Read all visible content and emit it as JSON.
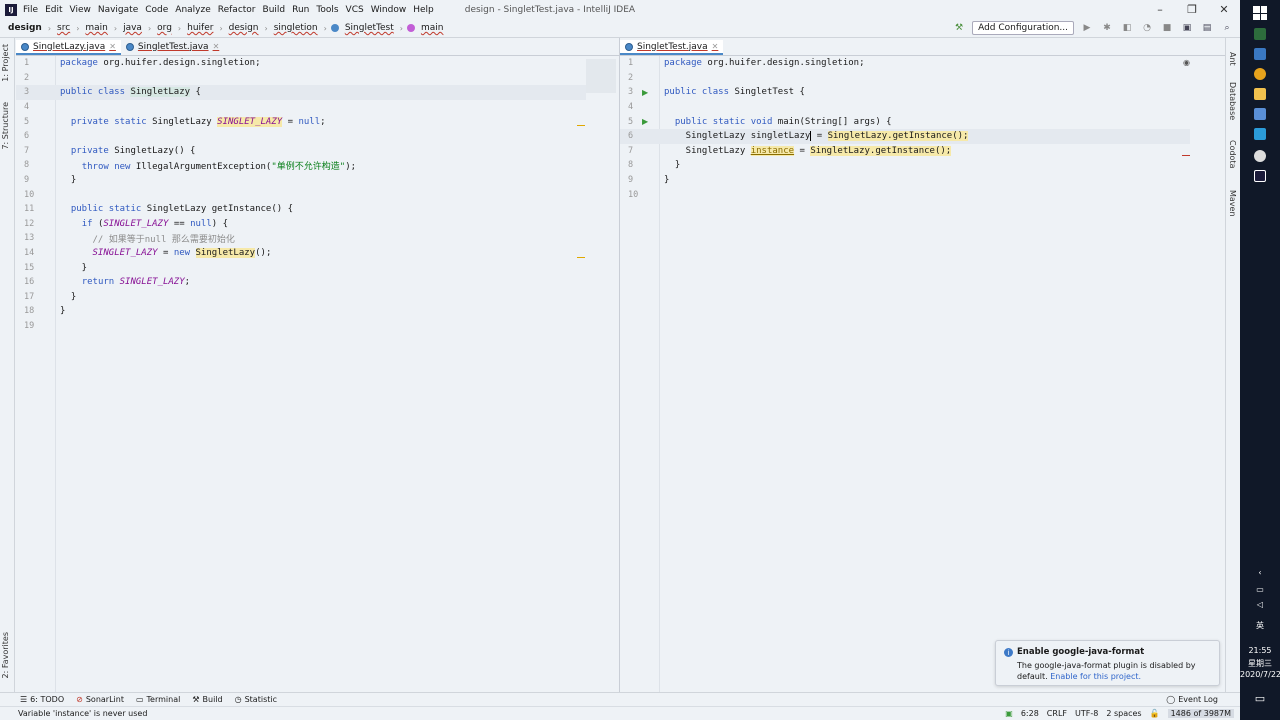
{
  "menu": {
    "items": [
      "File",
      "Edit",
      "View",
      "Navigate",
      "Code",
      "Analyze",
      "Refactor",
      "Build",
      "Run",
      "Tools",
      "VCS",
      "Window",
      "Help"
    ],
    "window_title": "design - SingletTest.java - IntelliJ IDEA"
  },
  "breadcrumb": [
    "design",
    "src",
    "main",
    "java",
    "org",
    "huifer",
    "design",
    "singletion",
    "SingletTest",
    "main"
  ],
  "toolbar": {
    "add_config_label": "Add Configuration..."
  },
  "left_strip": {
    "project": "1: Project",
    "structure": "7: Structure",
    "favorites": "2: Favorites"
  },
  "right_strip": {
    "ant": "Ant",
    "database": "Database",
    "codota": "Codota",
    "maven": "Maven"
  },
  "left_tabs": [
    {
      "label": "SingletLazy.java"
    },
    {
      "label": "SingletTest.java"
    }
  ],
  "right_tabs": [
    {
      "label": "SingletTest.java"
    }
  ],
  "left_code": [
    "package org.huifer.design.singletion;",
    "",
    "public class SingletLazy {",
    "",
    "  private static SingletLazy SINGLET_LAZY = null;",
    "",
    "  private SingletLazy() {",
    "    throw new IllegalArgumentException(\"单例不允许构造\");",
    "  }",
    "",
    "  public static SingletLazy getInstance() {",
    "    if (SINGLET_LAZY == null) {",
    "      // 如果等于null 那么需要初始化",
    "      SINGLET_LAZY = new SingletLazy();",
    "    }",
    "    return SINGLET_LAZY;",
    "  }",
    "}",
    ""
  ],
  "right_code": [
    "package org.huifer.design.singletion;",
    "",
    "public class SingletTest {",
    "",
    "  public static void main(String[] args) {",
    "    SingletLazy singletLazy = SingletLazy.getInstance();",
    "    SingletLazy instance = SingletLazy.getInstance();",
    "  }",
    "}",
    ""
  ],
  "bottom_tools": [
    "6: TODO",
    "SonarLint",
    "Terminal",
    "Build",
    "Statistic"
  ],
  "event_log": "Event Log",
  "status": {
    "message": "Variable 'instance' is never used",
    "position": "6:28",
    "line_sep": "CRLF",
    "encoding": "UTF-8",
    "indent": "2 spaces",
    "memory": "1486 of 3987M"
  },
  "notification": {
    "title": "Enable google-java-format",
    "body": "The google-java-format plugin is disabled by default.",
    "link": "Enable for this project."
  },
  "taskbar": {
    "time": "21:55",
    "day": "星期三",
    "date": "2020/7/22",
    "ime": "英"
  },
  "colors": {
    "accent": "#4a88c7",
    "keyword": "#0033b3",
    "field": "#871094",
    "string": "#067d17",
    "warning": "#e0a800"
  }
}
